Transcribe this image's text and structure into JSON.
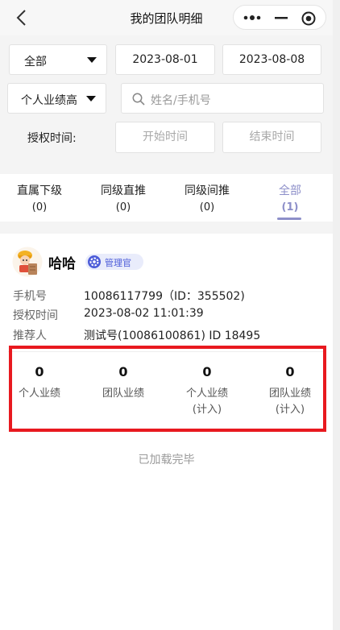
{
  "navbar": {
    "title": "我的团队明细",
    "back_icon": "chevron-left-icon",
    "menu_icons": [
      "more-dots-icon",
      "minimize-icon",
      "target-close-icon"
    ]
  },
  "filters": {
    "scope_value": "全部",
    "date_start": "2023-08-01",
    "date_end": "2023-08-08",
    "sort_value": "个人业绩高",
    "search_placeholder": "姓名/手机号",
    "auth_time_label": "授权时间:",
    "auth_start_placeholder": "开始时间",
    "auth_end_placeholder": "结束时间"
  },
  "tabs": [
    {
      "label": "直属下级",
      "count": "(0)"
    },
    {
      "label": "同级直推",
      "count": "(0)"
    },
    {
      "label": "同级间推",
      "count": "(0)"
    },
    {
      "label": "全部",
      "count": "(1)"
    }
  ],
  "member": {
    "name": "哈哈",
    "role_badge": "管理官",
    "phone_label": "手机号",
    "phone_value": "10086117799（ID：355502)",
    "auth_label": "授权时间",
    "auth_value": "2023-08-02 11:01:39",
    "referrer_label": "推荐人",
    "referrer_value": "测试号(10086100861) ID 18495",
    "stats": [
      {
        "value": "0",
        "label_line1": "个人业绩",
        "label_line2": ""
      },
      {
        "value": "0",
        "label_line1": "团队业绩",
        "label_line2": ""
      },
      {
        "value": "0",
        "label_line1": "个人业绩",
        "label_line2": "(计入)"
      },
      {
        "value": "0",
        "label_line1": "团队业绩",
        "label_line2": "(计入)"
      }
    ]
  },
  "footer": {
    "loaded_text": "已加载完毕"
  },
  "colors": {
    "accent": "#8d8fc9",
    "highlight_box": "#e8191f",
    "badge_text": "#4b5bd8"
  }
}
